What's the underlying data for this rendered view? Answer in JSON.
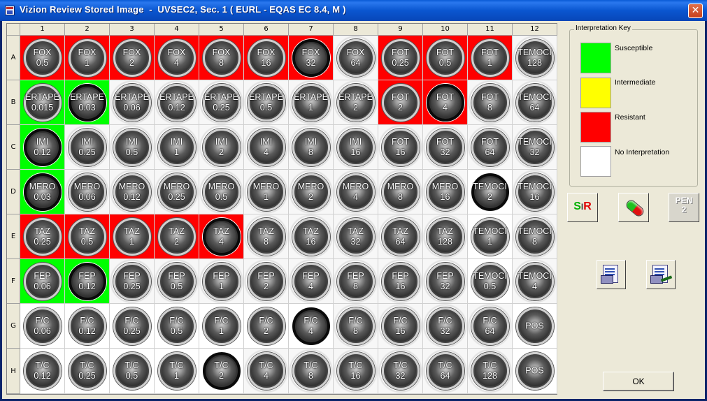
{
  "window": {
    "title": "Vizion Review Stored Image  -  UVSEC2, Sec. 1 ( EURL - EQAS EC 8.4, M )",
    "close_glyph": "✕"
  },
  "plate": {
    "columns": [
      "1",
      "2",
      "3",
      "4",
      "5",
      "6",
      "7",
      "8",
      "9",
      "10",
      "11",
      "12"
    ],
    "rows": [
      {
        "label": "A",
        "wells": [
          {
            "drug": "FOX",
            "conc": "0.5",
            "interp": "resistant",
            "growth": false
          },
          {
            "drug": "FOX",
            "conc": "1",
            "interp": "resistant",
            "growth": false
          },
          {
            "drug": "FOX",
            "conc": "2",
            "interp": "resistant",
            "growth": false
          },
          {
            "drug": "FOX",
            "conc": "4",
            "interp": "resistant",
            "growth": false
          },
          {
            "drug": "FOX",
            "conc": "8",
            "interp": "resistant",
            "growth": false
          },
          {
            "drug": "FOX",
            "conc": "16",
            "interp": "resistant",
            "growth": false
          },
          {
            "drug": "FOX",
            "conc": "32",
            "interp": "resistant",
            "growth": true
          },
          {
            "drug": "FOX",
            "conc": "64",
            "interp": "plain",
            "growth": false
          },
          {
            "drug": "FOT",
            "conc": "0.25",
            "interp": "resistant",
            "growth": false
          },
          {
            "drug": "FOT",
            "conc": "0.5",
            "interp": "resistant",
            "growth": false
          },
          {
            "drug": "FOT",
            "conc": "1",
            "interp": "resistant",
            "growth": false
          },
          {
            "drug": "TEMOCI",
            "conc": "128",
            "interp": "plain",
            "growth": false
          }
        ]
      },
      {
        "label": "B",
        "wells": [
          {
            "drug": "ERTAPE",
            "conc": "0.015",
            "interp": "susceptible",
            "growth": false
          },
          {
            "drug": "ERTAPE",
            "conc": "0.03",
            "interp": "susceptible",
            "growth": true
          },
          {
            "drug": "ERTAPE",
            "conc": "0.06",
            "interp": "plain",
            "growth": false
          },
          {
            "drug": "ERTAPE",
            "conc": "0.12",
            "interp": "plain",
            "growth": false
          },
          {
            "drug": "ERTAPE",
            "conc": "0.25",
            "interp": "plain",
            "growth": false
          },
          {
            "drug": "ERTAPE",
            "conc": "0.5",
            "interp": "plain",
            "growth": false
          },
          {
            "drug": "ERTAPE",
            "conc": "1",
            "interp": "plain",
            "growth": false
          },
          {
            "drug": "ERTAPE",
            "conc": "2",
            "interp": "plain",
            "growth": false
          },
          {
            "drug": "FOT",
            "conc": "2",
            "interp": "resistant",
            "growth": false
          },
          {
            "drug": "FOT",
            "conc": "4",
            "interp": "resistant",
            "growth": true
          },
          {
            "drug": "FOT",
            "conc": "8",
            "interp": "plain",
            "growth": false
          },
          {
            "drug": "TEMOCI",
            "conc": "64",
            "interp": "plain",
            "growth": false
          }
        ]
      },
      {
        "label": "C",
        "wells": [
          {
            "drug": "IMI",
            "conc": "0.12",
            "interp": "susceptible",
            "growth": true
          },
          {
            "drug": "IMI",
            "conc": "0.25",
            "interp": "plain",
            "growth": false
          },
          {
            "drug": "IMI",
            "conc": "0.5",
            "interp": "plain",
            "growth": false
          },
          {
            "drug": "IMI",
            "conc": "1",
            "interp": "plain",
            "growth": false
          },
          {
            "drug": "IMI",
            "conc": "2",
            "interp": "plain",
            "growth": false
          },
          {
            "drug": "IMI",
            "conc": "4",
            "interp": "plain",
            "growth": false
          },
          {
            "drug": "IMI",
            "conc": "8",
            "interp": "plain",
            "growth": false
          },
          {
            "drug": "IMI",
            "conc": "16",
            "interp": "plain",
            "growth": false
          },
          {
            "drug": "FOT",
            "conc": "16",
            "interp": "plain",
            "growth": false
          },
          {
            "drug": "FOT",
            "conc": "32",
            "interp": "plain",
            "growth": false
          },
          {
            "drug": "FOT",
            "conc": "64",
            "interp": "plain",
            "growth": false
          },
          {
            "drug": "TEMOCI",
            "conc": "32",
            "interp": "plain",
            "growth": false
          }
        ]
      },
      {
        "label": "D",
        "wells": [
          {
            "drug": "MERO",
            "conc": "0.03",
            "interp": "susceptible",
            "growth": true
          },
          {
            "drug": "MERO",
            "conc": "0.06",
            "interp": "plain",
            "growth": false
          },
          {
            "drug": "MERO",
            "conc": "0.12",
            "interp": "plain",
            "growth": false
          },
          {
            "drug": "MERO",
            "conc": "0.25",
            "interp": "plain",
            "growth": false
          },
          {
            "drug": "MERO",
            "conc": "0.5",
            "interp": "plain",
            "growth": false
          },
          {
            "drug": "MERO",
            "conc": "1",
            "interp": "plain",
            "growth": false
          },
          {
            "drug": "MERO",
            "conc": "2",
            "interp": "plain",
            "growth": false
          },
          {
            "drug": "MERO",
            "conc": "4",
            "interp": "plain",
            "growth": false
          },
          {
            "drug": "MERO",
            "conc": "8",
            "interp": "plain",
            "growth": false
          },
          {
            "drug": "MERO",
            "conc": "16",
            "interp": "plain",
            "growth": false
          },
          {
            "drug": "TEMOCI",
            "conc": "2",
            "interp": "none",
            "growth": true
          },
          {
            "drug": "TEMOCI",
            "conc": "16",
            "interp": "plain",
            "growth": false
          }
        ]
      },
      {
        "label": "E",
        "wells": [
          {
            "drug": "TAZ",
            "conc": "0.25",
            "interp": "resistant",
            "growth": false
          },
          {
            "drug": "TAZ",
            "conc": "0.5",
            "interp": "resistant",
            "growth": false
          },
          {
            "drug": "TAZ",
            "conc": "1",
            "interp": "resistant",
            "growth": false
          },
          {
            "drug": "TAZ",
            "conc": "2",
            "interp": "resistant",
            "growth": false
          },
          {
            "drug": "TAZ",
            "conc": "4",
            "interp": "resistant",
            "growth": true
          },
          {
            "drug": "TAZ",
            "conc": "8",
            "interp": "plain",
            "growth": false
          },
          {
            "drug": "TAZ",
            "conc": "16",
            "interp": "plain",
            "growth": false
          },
          {
            "drug": "TAZ",
            "conc": "32",
            "interp": "plain",
            "growth": false
          },
          {
            "drug": "TAZ",
            "conc": "64",
            "interp": "plain",
            "growth": false
          },
          {
            "drug": "TAZ",
            "conc": "128",
            "interp": "plain",
            "growth": false
          },
          {
            "drug": "TEMOCI",
            "conc": "1",
            "interp": "none",
            "growth": false
          },
          {
            "drug": "TEMOCI",
            "conc": "8",
            "interp": "plain",
            "growth": false
          }
        ]
      },
      {
        "label": "F",
        "wells": [
          {
            "drug": "FEP",
            "conc": "0.06",
            "interp": "susceptible",
            "growth": false
          },
          {
            "drug": "FEP",
            "conc": "0.12",
            "interp": "susceptible",
            "growth": true
          },
          {
            "drug": "FEP",
            "conc": "0.25",
            "interp": "plain",
            "growth": false
          },
          {
            "drug": "FEP",
            "conc": "0.5",
            "interp": "plain",
            "growth": false
          },
          {
            "drug": "FEP",
            "conc": "1",
            "interp": "plain",
            "growth": false
          },
          {
            "drug": "FEP",
            "conc": "2",
            "interp": "plain",
            "growth": false
          },
          {
            "drug": "FEP",
            "conc": "4",
            "interp": "plain",
            "growth": false
          },
          {
            "drug": "FEP",
            "conc": "8",
            "interp": "plain",
            "growth": false
          },
          {
            "drug": "FEP",
            "conc": "16",
            "interp": "plain",
            "growth": false
          },
          {
            "drug": "FEP",
            "conc": "32",
            "interp": "plain",
            "growth": false
          },
          {
            "drug": "TEMOCI",
            "conc": "0.5",
            "interp": "none",
            "growth": false
          },
          {
            "drug": "TEMOCI",
            "conc": "4",
            "interp": "plain",
            "growth": false
          }
        ]
      },
      {
        "label": "G",
        "wells": [
          {
            "drug": "F/C",
            "conc": "0.06",
            "interp": "none",
            "growth": false
          },
          {
            "drug": "F/C",
            "conc": "0.12",
            "interp": "none",
            "growth": false
          },
          {
            "drug": "F/C",
            "conc": "0.25",
            "interp": "none",
            "growth": false
          },
          {
            "drug": "F/C",
            "conc": "0.5",
            "interp": "none",
            "growth": false
          },
          {
            "drug": "F/C",
            "conc": "1",
            "interp": "none",
            "growth": false
          },
          {
            "drug": "F/C",
            "conc": "2",
            "interp": "none",
            "growth": false
          },
          {
            "drug": "F/C",
            "conc": "4",
            "interp": "none",
            "growth": true
          },
          {
            "drug": "F/C",
            "conc": "8",
            "interp": "plain",
            "growth": false
          },
          {
            "drug": "F/C",
            "conc": "16",
            "interp": "plain",
            "growth": false
          },
          {
            "drug": "F/C",
            "conc": "32",
            "interp": "plain",
            "growth": false
          },
          {
            "drug": "F/C",
            "conc": "64",
            "interp": "plain",
            "growth": false
          },
          {
            "drug": "POS",
            "conc": "",
            "interp": "none",
            "growth": false
          }
        ]
      },
      {
        "label": "H",
        "wells": [
          {
            "drug": "T/C",
            "conc": "0.12",
            "interp": "none",
            "growth": false
          },
          {
            "drug": "T/C",
            "conc": "0.25",
            "interp": "none",
            "growth": false
          },
          {
            "drug": "T/C",
            "conc": "0.5",
            "interp": "none",
            "growth": false
          },
          {
            "drug": "T/C",
            "conc": "1",
            "interp": "none",
            "growth": false
          },
          {
            "drug": "T/C",
            "conc": "2",
            "interp": "none",
            "growth": true
          },
          {
            "drug": "T/C",
            "conc": "4",
            "interp": "plain",
            "growth": false
          },
          {
            "drug": "T/C",
            "conc": "8",
            "interp": "plain",
            "growth": false
          },
          {
            "drug": "T/C",
            "conc": "16",
            "interp": "plain",
            "growth": false
          },
          {
            "drug": "T/C",
            "conc": "32",
            "interp": "plain",
            "growth": false
          },
          {
            "drug": "T/C",
            "conc": "64",
            "interp": "plain",
            "growth": false
          },
          {
            "drug": "T/C",
            "conc": "128",
            "interp": "plain",
            "growth": false
          },
          {
            "drug": "POS",
            "conc": "",
            "interp": "none",
            "growth": false
          }
        ]
      }
    ]
  },
  "interpretation_key": {
    "title": "Interpretation Key",
    "items": [
      {
        "label": "Susceptible",
        "color": "#00ff00"
      },
      {
        "label": "Intermediate",
        "color": "#ffff00"
      },
      {
        "label": "Resistant",
        "color": "#ff0000"
      },
      {
        "label": "No Interpretation",
        "color": "#ffffff"
      }
    ]
  },
  "toolbar": {
    "sir_button": {
      "s": "S",
      "sep": "I",
      "r": "R",
      "icon": "sir-icon"
    },
    "drug_button": {
      "icon": "capsule-icon"
    },
    "pen_button": {
      "line1": "PEN",
      "line2": "2"
    },
    "print_button": {
      "icon": "print-doc-icon"
    },
    "edit_print_button": {
      "icon": "edit-doc-icon"
    }
  },
  "ok_label": "OK"
}
